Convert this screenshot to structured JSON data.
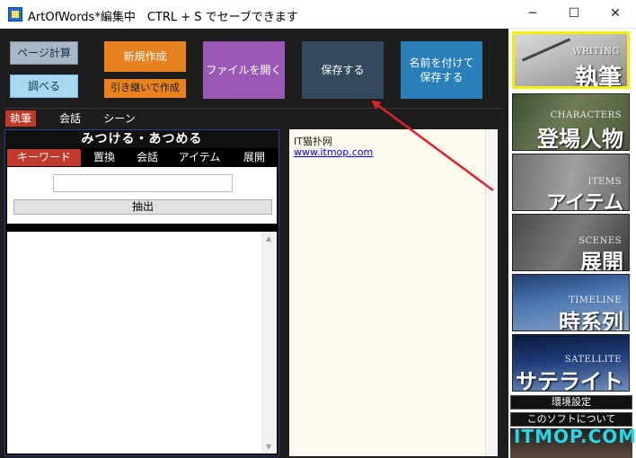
{
  "window": {
    "title": "ArtOfWords*編集中　CTRL + S でセーブできます",
    "minimize_glyph": "─",
    "maximize_glyph": "☐",
    "close_glyph": "✕"
  },
  "toolbar": {
    "page_calc": "ページ計算",
    "lookup": "調べる",
    "new_create": "新規作成",
    "continue_create": "引き継いで作成",
    "open_file": "ファイルを開く",
    "save": "保存する",
    "save_as": "名前を付けて\n保存する"
  },
  "main_tabs": [
    "執筆",
    "会話",
    "シーン"
  ],
  "search_panel": {
    "heading": "みつける・あつめる",
    "tabs": [
      "キーワード",
      "置換",
      "会話",
      "アイテム",
      "展開"
    ],
    "input_value": "",
    "extract_label": "抽出"
  },
  "editor": {
    "line1": "IT猫扑网",
    "link": "www.itmop.com"
  },
  "sidebar": {
    "tiles": [
      {
        "eng": "WRITING",
        "jp": "執筆"
      },
      {
        "eng": "CHARACTERS",
        "jp": "登場人物"
      },
      {
        "eng": "ITEMS",
        "jp": "アイテム"
      },
      {
        "eng": "SCENES",
        "jp": "展開"
      },
      {
        "eng": "TIMELINE",
        "jp": "時系列"
      },
      {
        "eng": "SATELLITE",
        "jp": "サテライト"
      }
    ],
    "settings": "環境設定",
    "about": "このソフトについて"
  },
  "watermark": "ITMOP.COM",
  "colors": {
    "active_tab": "#c0392b",
    "selected_tile_border": "#f4f000",
    "arrow": "#e0202a"
  }
}
